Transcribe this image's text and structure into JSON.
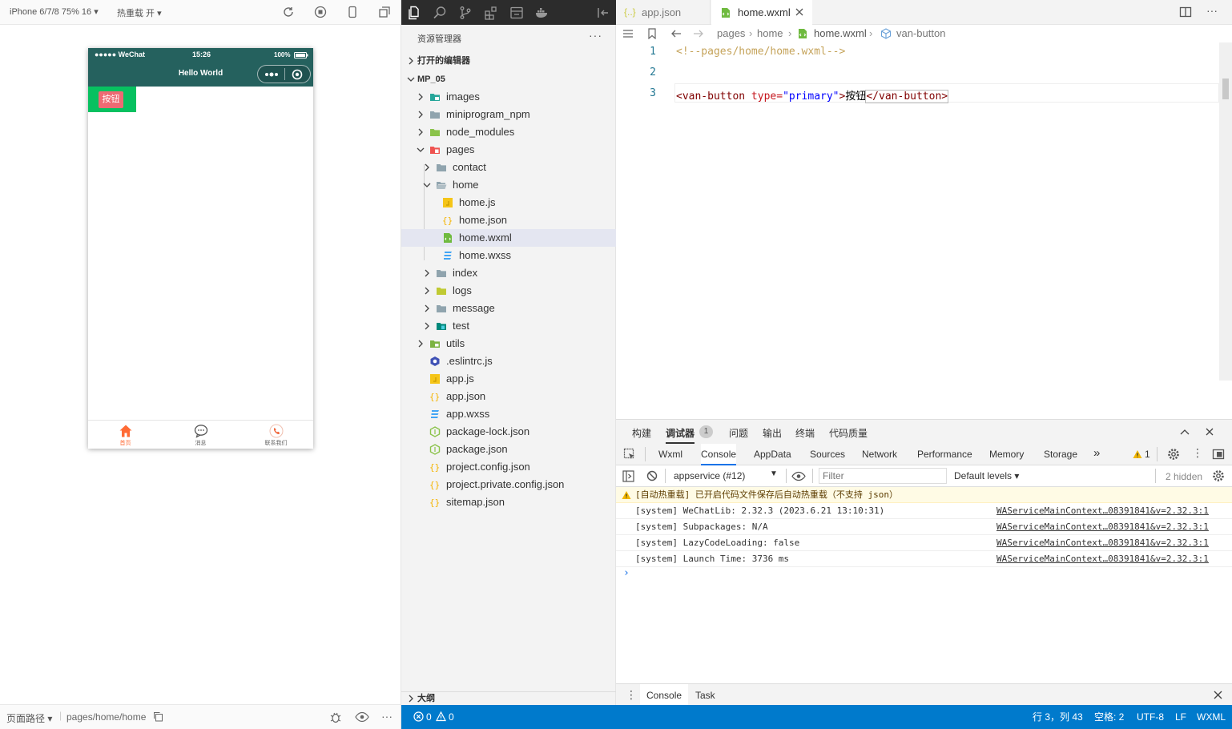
{
  "simulator": {
    "device_select": "iPhone 6/7/8 75% 16 ▾",
    "hot_reload": "热重载 开 ▾",
    "phone": {
      "carrier": "●●●●● WeChat",
      "time": "15:26",
      "battery": "100%",
      "nav_title": "Hello World",
      "button_label": "按钮",
      "tabs": [
        "首页",
        "消息",
        "联系我们"
      ]
    },
    "status": {
      "path_label": "页面路径 ▾",
      "path": "pages/home/home"
    }
  },
  "explorer": {
    "title": "资源管理器",
    "more": "···",
    "open_editors": "打开的编辑器",
    "project": "MP_05",
    "outline": "大纲",
    "items": [
      {
        "label": "images"
      },
      {
        "label": "miniprogram_npm"
      },
      {
        "label": "node_modules"
      },
      {
        "label": "pages"
      },
      {
        "label": "contact"
      },
      {
        "label": "home"
      },
      {
        "label": "home.js"
      },
      {
        "label": "home.json"
      },
      {
        "label": "home.wxml"
      },
      {
        "label": "home.wxss"
      },
      {
        "label": "index"
      },
      {
        "label": "logs"
      },
      {
        "label": "message"
      },
      {
        "label": "test"
      },
      {
        "label": "utils"
      },
      {
        "label": ".eslintrc.js"
      },
      {
        "label": "app.js"
      },
      {
        "label": "app.json"
      },
      {
        "label": "app.wxss"
      },
      {
        "label": "package-lock.json"
      },
      {
        "label": "package.json"
      },
      {
        "label": "project.config.json"
      },
      {
        "label": "project.private.config.json"
      },
      {
        "label": "sitemap.json"
      }
    ]
  },
  "editor": {
    "tabs": [
      "app.json",
      "home.wxml"
    ],
    "breadcrumb": [
      "pages",
      "home",
      "home.wxml",
      "van-button"
    ],
    "line_numbers": [
      "1",
      "2",
      "3"
    ],
    "line1": "<!--pages/home/home.wxml-->",
    "line3": {
      "open": "<van-button",
      "attr": " type=",
      "val": "\"primary\"",
      "close_open": ">",
      "text": "按钮",
      "end": "</van-button>"
    }
  },
  "devtools": {
    "top_tabs": [
      "构建",
      "调试器",
      "问题",
      "输出",
      "终端",
      "代码质量"
    ],
    "debugger_badge": "1",
    "panel_tabs": [
      "Wxml",
      "Console",
      "AppData",
      "Sources",
      "Network",
      "Performance",
      "Memory",
      "Storage"
    ],
    "more_tabs": "»",
    "warn_count": "1",
    "context": "appservice (#12)",
    "filter_placeholder": "Filter",
    "levels": "Default levels ▾",
    "hidden": "2 hidden",
    "logs": [
      {
        "msg": "[自动热重载] 已开启代码文件保存后自动热重载（不支持 json）",
        "src": ""
      },
      {
        "msg": "[system] WeChatLib: 2.32.3 (2023.6.21 13:10:31)",
        "src": "WAServiceMainContext…08391841&v=2.32.3:1"
      },
      {
        "msg": "[system] Subpackages: N/A",
        "src": "WAServiceMainContext…08391841&v=2.32.3:1"
      },
      {
        "msg": "[system] LazyCodeLoading: false",
        "src": "WAServiceMainContext…08391841&v=2.32.3:1"
      },
      {
        "msg": "[system] Launch Time: 3736 ms",
        "src": "WAServiceMainContext…08391841&v=2.32.3:1"
      }
    ],
    "prompt": "›",
    "drawer_tabs": [
      "Console",
      "Task"
    ]
  },
  "statusbar": {
    "errors": "0",
    "warnings": "0",
    "position": "行 3，列 43",
    "spaces": "空格: 2",
    "encoding": "UTF-8",
    "eol": "LF",
    "language": "WXML"
  },
  "colors": {
    "nav_bg": "#25615e",
    "wechat_green": "#07c160",
    "button_red": "#ee6a73",
    "status_blue": "#007acc"
  }
}
